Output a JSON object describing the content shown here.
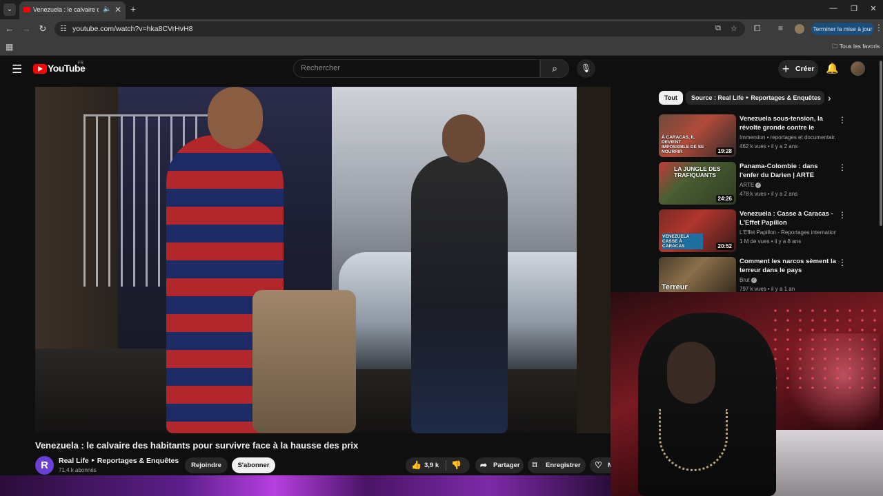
{
  "browser": {
    "tab_title": "Venezuela : le calvaire des h",
    "url": "youtube.com/watch?v=hka8CVrHvH8",
    "update_button": "Terminer la mise à jour",
    "bookmarks_folder": "Tous les favoris"
  },
  "masthead": {
    "logo_text": "YouTube",
    "country_code": "FR",
    "search_placeholder": "Rechercher",
    "create_label": "Créer"
  },
  "video": {
    "title": "Venezuela : le calvaire des habitants pour survivre face à la hausse des prix",
    "channel_name": "Real Life ‣ Reportages & Enquêtes",
    "channel_initial": "R",
    "subscribers": "71,4 k abonnés",
    "join_label": "Rejoindre",
    "subscribe_label": "S'abonner",
    "likes": "3,9 k",
    "share_label": "Partager",
    "save_label": "Enregistrer",
    "more_label": "M"
  },
  "sidebar": {
    "chips": [
      "Tout",
      "Source : Real Life ‣ Reportages & Enquêtes"
    ],
    "recommendations": [
      {
        "title": "Venezuela sous-tension, la révolte gronde contre le régim...",
        "channel": "Immersion • reportages et documentair...",
        "views": "462 k vues",
        "age": "il y a 2 ans",
        "duration": "19:28",
        "thumb_text": "À CARACAS, IL DEVIENT IMPOSSIBLE DE SE NOURRIR"
      },
      {
        "title": "Panama-Colombie : dans l'enfer du Darien | ARTE Reportage",
        "channel": "ARTE",
        "views": "478 k vues",
        "age": "il y a 2 ans",
        "duration": "24:26",
        "thumb_text": "LA JUNGLE DES TRAFIQUANTS"
      },
      {
        "title": "Venezuela : Casse à Caracas - L'Effet Papillon",
        "channel": "L'Effet Papillon - Reportages internationa...",
        "views": "1 M de vues",
        "age": "il y a 8 ans",
        "duration": "20:52",
        "thumb_text": "VENEZUELA CASSE À CARACAS"
      },
      {
        "title": "Comment les narcos sèment la terreur dans le pays",
        "channel": "Brut",
        "views": "797 k vues",
        "age": "il y a 1 an",
        "duration": "",
        "thumb_text": "Terreur"
      }
    ]
  },
  "colors": {
    "youtube_red": "#ff0000",
    "background": "#0f0f0f",
    "chip_active": "#f1f1f1"
  }
}
